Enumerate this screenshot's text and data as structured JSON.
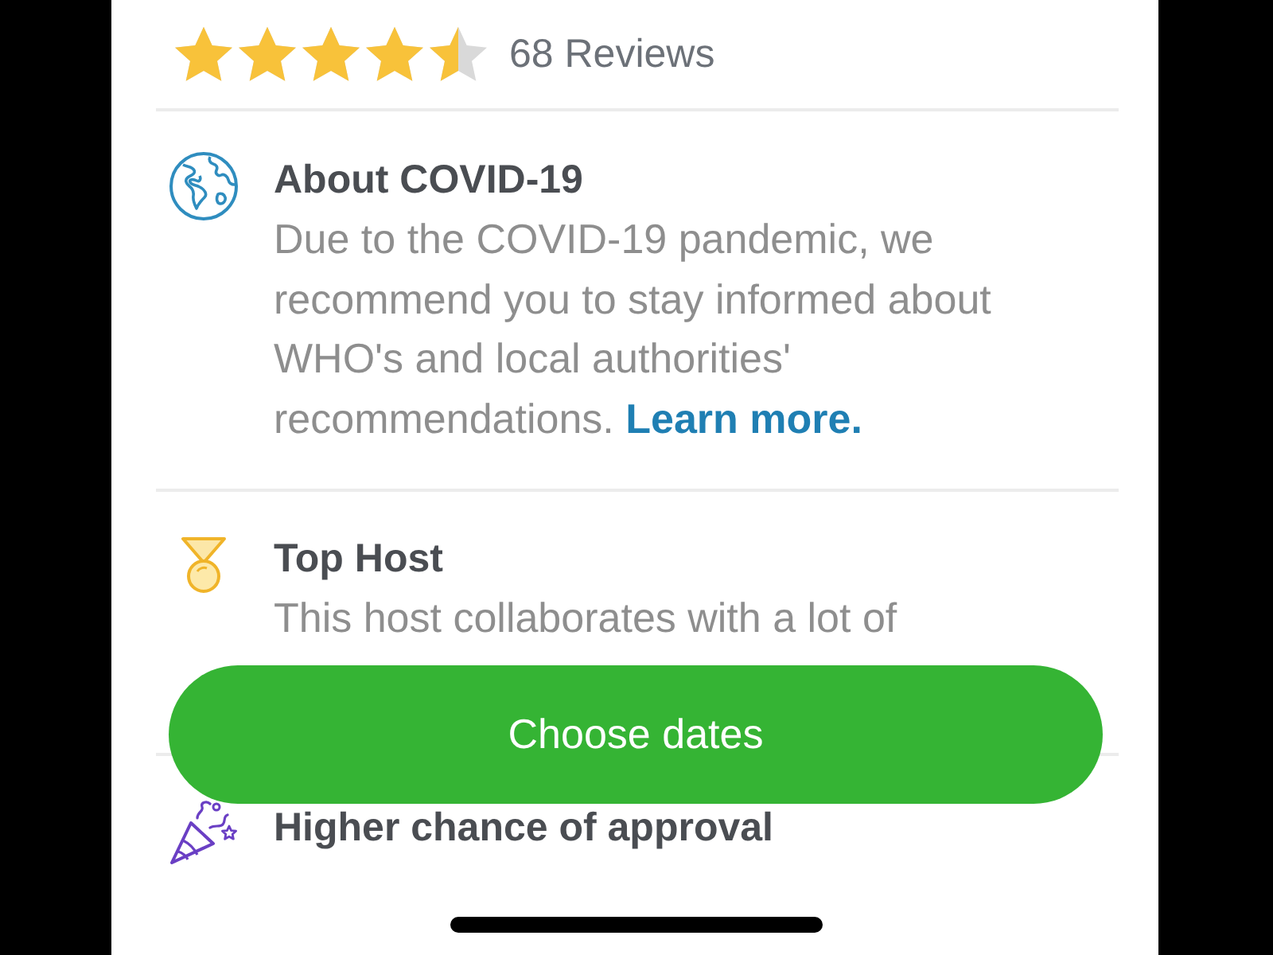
{
  "rating": {
    "stars": 4.5,
    "reviews": "68 Reviews"
  },
  "features": [
    {
      "kind": "globe",
      "title": "About COVID-19",
      "text": "Due to the COVID-19 pandemic, we recommend you to stay informed about WHO's and local authorities' recommendations.",
      "link": "Learn more."
    },
    {
      "kind": "medal",
      "title": "Top Host",
      "text": "This host collaborates with a lot of"
    },
    {
      "kind": "party",
      "title": "Higher chance of approval"
    }
  ],
  "cta": {
    "label": "Choose dates"
  }
}
